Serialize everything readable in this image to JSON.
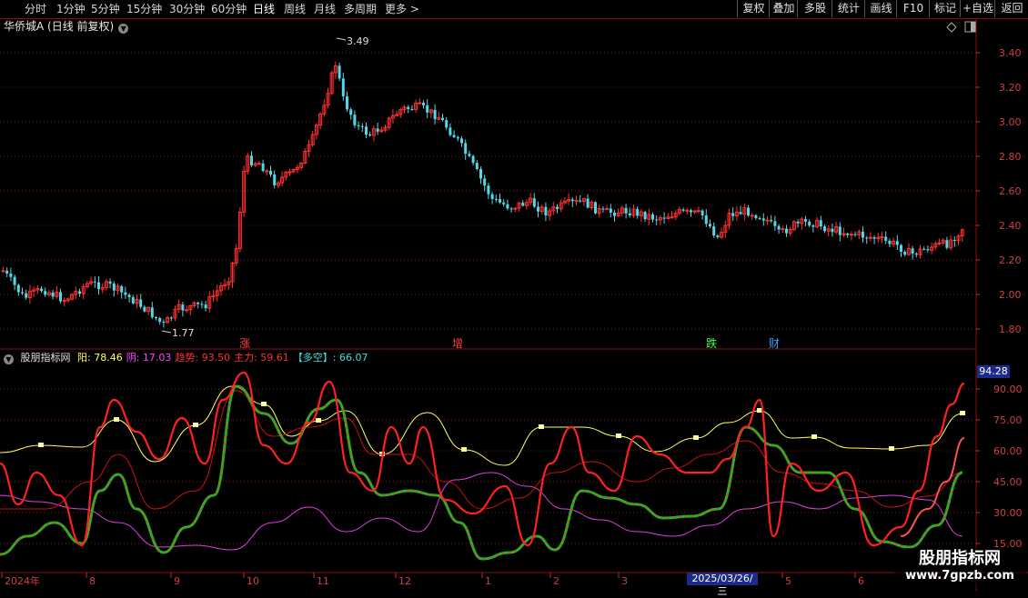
{
  "toolbar": {
    "periods": [
      {
        "label": "分时",
        "active": false
      },
      {
        "label": "1分钟",
        "active": false
      },
      {
        "label": "5分钟",
        "active": false
      },
      {
        "label": "15分钟",
        "active": false
      },
      {
        "label": "30分钟",
        "active": false
      },
      {
        "label": "60分钟",
        "active": false
      },
      {
        "label": "日线",
        "active": true
      },
      {
        "label": "周线",
        "active": false
      },
      {
        "label": "月线",
        "active": false
      },
      {
        "label": "多周期",
        "active": false
      },
      {
        "label": "更多 >",
        "active": false
      }
    ],
    "right_buttons": [
      "复权",
      "叠加",
      "多股",
      "统计",
      "画线",
      "F10",
      "标记",
      "+自选",
      "返回"
    ]
  },
  "chart_title": "华侨城A (日线 前复权)",
  "price_axis": {
    "ticks": [
      "3.40",
      "3.20",
      "3.00",
      "2.80",
      "2.60",
      "2.40",
      "2.20",
      "2.00",
      "1.80"
    ]
  },
  "annotations": {
    "high": "3.49",
    "low": "1.77"
  },
  "markers": [
    {
      "label": "涨",
      "color": "#ff4040"
    },
    {
      "label": "增",
      "color": "#ff4040"
    },
    {
      "label": "跌",
      "color": "#40ff40"
    },
    {
      "label": "财",
      "color": "#40a0ff"
    }
  ],
  "indicator": {
    "name": "股朋指标网",
    "items": [
      {
        "label": "阳:",
        "value": "78.46",
        "color": "#ffff60"
      },
      {
        "label": "阴:",
        "value": "17.03",
        "color": "#ff40ff"
      },
      {
        "label": "趋势:",
        "value": "93.50",
        "color": "#ff3030"
      },
      {
        "label": "主力:",
        "value": "59.61",
        "color": "#ff3030"
      },
      {
        "label": "【多空】:",
        "value": "66.07",
        "color": "#40e0e0"
      }
    ],
    "current_value": "94.28",
    "axis_ticks": [
      "90.00",
      "75.00",
      "60.00",
      "45.00",
      "30.00",
      "15.00"
    ]
  },
  "date_axis": {
    "labels": [
      "2024年",
      "8",
      "9",
      "10",
      "11",
      "12",
      "1",
      "2",
      "3",
      "5",
      "6"
    ],
    "cursor_date": "2025/03/26/三"
  },
  "watermark": {
    "line1": "股朋指标网",
    "line2": "www.7gpzb.com"
  },
  "colors": {
    "up": "#ff3030",
    "down": "#54d8e8",
    "yang": "#ffff60",
    "yin": "#e040e0",
    "trend": "#ff2020",
    "green": "#10c020",
    "grid": "#8a1010"
  }
}
